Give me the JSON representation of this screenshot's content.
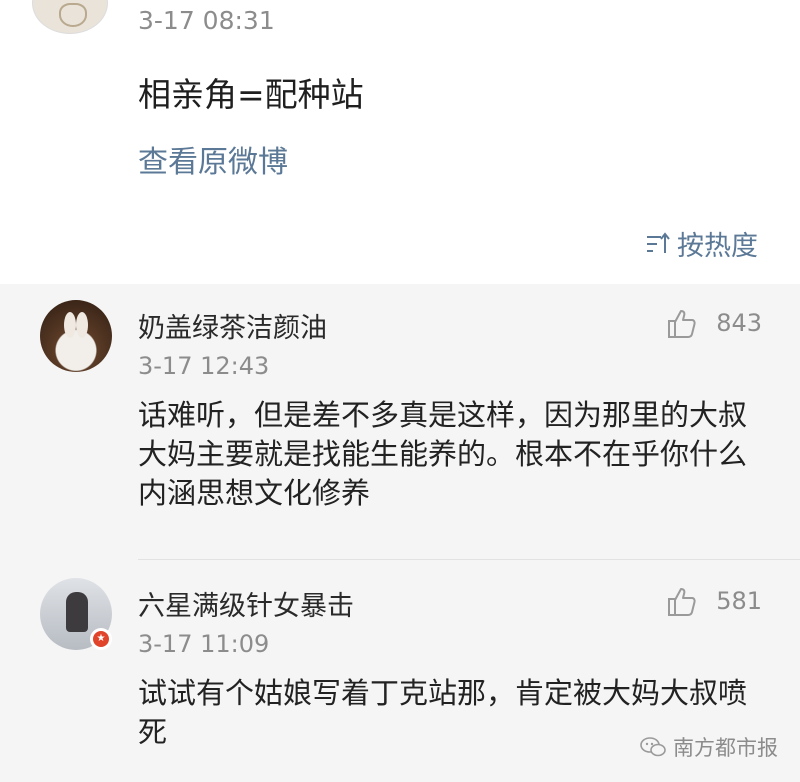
{
  "post": {
    "time": "3-17 08:31",
    "text": "相亲角=配种站",
    "view_original": "查看原微博",
    "sort_label": "按热度"
  },
  "comments": [
    {
      "name": "奶盖绿茶洁颜油",
      "time": "3-17 12:43",
      "text": "话难听，但是差不多真是这样，因为那里的大叔大妈主要就是找能生能养的。根本不在乎你什么内涵思想文化修养",
      "likes": "843"
    },
    {
      "name": "六星满级针女暴击",
      "time": "3-17 11:09",
      "text": "试试有个姑娘写着丁克站那，肯定被大妈大叔喷死",
      "likes": "581"
    }
  ],
  "watermark": "南方都市报",
  "icons": {
    "like": "thumbs-up-icon",
    "sort": "sort-icon",
    "verified": "verified-badge-icon",
    "wechat": "wechat-icon"
  },
  "colors": {
    "link": "#5b7896",
    "muted": "#8c8c8c",
    "comments_bg": "#f5f5f5",
    "badge": "#e0442b"
  }
}
